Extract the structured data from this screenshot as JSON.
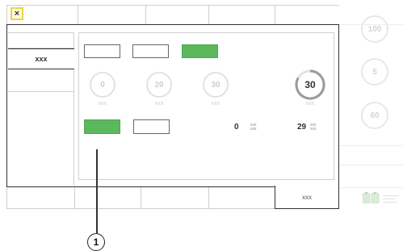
{
  "colors": {
    "accent_green": "#5cb85c",
    "close_box_border": "#e6d84a",
    "dial_ring_light": "#e2e2e2",
    "dial_ring_active": "#9a9a9a"
  },
  "titlebar": {
    "close_glyph": "×"
  },
  "sidebar": {
    "selected_label": "xxx"
  },
  "dials": [
    {
      "value": "0",
      "label": "xxx"
    },
    {
      "value": "20",
      "label": "xxx"
    },
    {
      "value": "30",
      "label": "xxx"
    },
    {
      "value": "30",
      "label": "xxx"
    }
  ],
  "readouts": [
    {
      "value": "0",
      "unit_top": "xxx",
      "unit_bottom": "xxx"
    },
    {
      "value": "29",
      "unit_top": "xxx",
      "unit_bottom": "xxx"
    }
  ],
  "right_dials": [
    "100",
    "5",
    "60"
  ],
  "bottom_tab": {
    "label": "xxx"
  },
  "callout": {
    "number": "1"
  }
}
